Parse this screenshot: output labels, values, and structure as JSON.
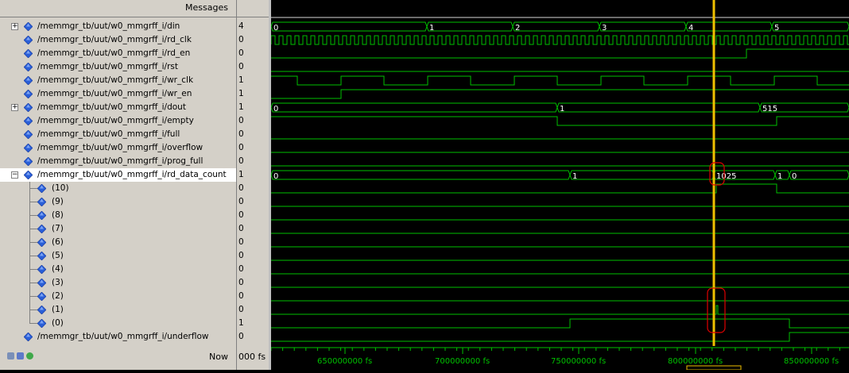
{
  "header": {
    "messages_label": "Messages"
  },
  "signals": [
    {
      "id": "din",
      "name": "/memmgr_tb/uut/w0_mmgrff_i/din",
      "value": "4",
      "expandable": true,
      "expanded": false,
      "indent": 0
    },
    {
      "id": "rd_clk",
      "name": "/memmgr_tb/uut/w0_mmgrff_i/rd_clk",
      "value": "0",
      "indent": 0
    },
    {
      "id": "rd_en",
      "name": "/memmgr_tb/uut/w0_mmgrff_i/rd_en",
      "value": "0",
      "indent": 0
    },
    {
      "id": "rst",
      "name": "/memmgr_tb/uut/w0_mmgrff_i/rst",
      "value": "0",
      "indent": 0
    },
    {
      "id": "wr_clk",
      "name": "/memmgr_tb/uut/w0_mmgrff_i/wr_clk",
      "value": "1",
      "indent": 0
    },
    {
      "id": "wr_en",
      "name": "/memmgr_tb/uut/w0_mmgrff_i/wr_en",
      "value": "1",
      "indent": 0
    },
    {
      "id": "dout",
      "name": "/memmgr_tb/uut/w0_mmgrff_i/dout",
      "value": "1",
      "expandable": true,
      "expanded": false,
      "indent": 0
    },
    {
      "id": "empty",
      "name": "/memmgr_tb/uut/w0_mmgrff_i/empty",
      "value": "0",
      "indent": 0
    },
    {
      "id": "full",
      "name": "/memmgr_tb/uut/w0_mmgrff_i/full",
      "value": "0",
      "indent": 0
    },
    {
      "id": "overflow",
      "name": "/memmgr_tb/uut/w0_mmgrff_i/overflow",
      "value": "0",
      "indent": 0
    },
    {
      "id": "prog_full",
      "name": "/memmgr_tb/uut/w0_mmgrff_i/prog_full",
      "value": "0",
      "indent": 0
    },
    {
      "id": "rd_data_count",
      "name": "/memmgr_tb/uut/w0_mmgrff_i/rd_data_count",
      "value": "1",
      "expandable": true,
      "expanded": true,
      "selected": true,
      "indent": 0
    },
    {
      "id": "b10",
      "name": "(10)",
      "value": "0",
      "indent": 1
    },
    {
      "id": "b9",
      "name": "(9)",
      "value": "0",
      "indent": 1
    },
    {
      "id": "b8",
      "name": "(8)",
      "value": "0",
      "indent": 1
    },
    {
      "id": "b7",
      "name": "(7)",
      "value": "0",
      "indent": 1
    },
    {
      "id": "b6",
      "name": "(6)",
      "value": "0",
      "indent": 1
    },
    {
      "id": "b5",
      "name": "(5)",
      "value": "0",
      "indent": 1
    },
    {
      "id": "b4",
      "name": "(4)",
      "value": "0",
      "indent": 1
    },
    {
      "id": "b3",
      "name": "(3)",
      "value": "0",
      "indent": 1
    },
    {
      "id": "b2",
      "name": "(2)",
      "value": "0",
      "indent": 1
    },
    {
      "id": "b1",
      "name": "(1)",
      "value": "0",
      "indent": 1
    },
    {
      "id": "b0",
      "name": "(0)",
      "value": "1",
      "indent": 1
    },
    {
      "id": "underflow",
      "name": "/memmgr_tb/uut/w0_mmgrff_i/underflow",
      "value": "0",
      "indent": 0
    }
  ],
  "bus_labels": {
    "din": [
      "0",
      "1",
      "2",
      "3",
      "4",
      "5"
    ],
    "dout": [
      "0",
      "1",
      "515"
    ],
    "rd_data_count": [
      "0",
      "1",
      "1025",
      "1",
      "0"
    ]
  },
  "footer": {
    "now_label": "Now",
    "now_value": "000 fs",
    "ticks": [
      "650000000 fs",
      "700000000 fs",
      "750000000 fs",
      "800000000 fs",
      "850000000 fs"
    ]
  },
  "colors": {
    "wave": "#00c000",
    "cursor": "#f0c000",
    "highlight": "#e00000",
    "diamond": "#2a5fd8"
  }
}
